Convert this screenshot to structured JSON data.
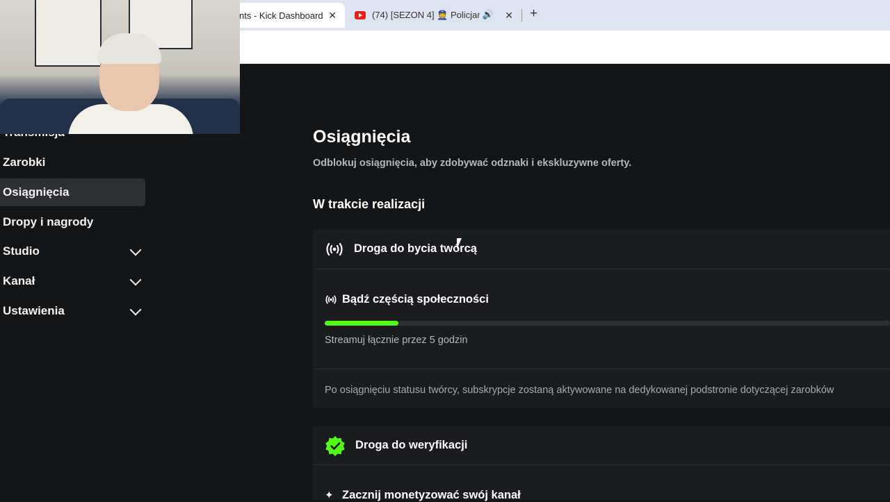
{
  "browser": {
    "tabs": [
      {
        "title": "nts - Kick Dashboard",
        "close": "✕"
      },
      {
        "title": "(74) [SEZON 4] 👮 Policjanc",
        "close": "✕",
        "audio": "🔊"
      }
    ],
    "new_tab": "+"
  },
  "sidebar": {
    "items": [
      {
        "label": "Transmisja"
      },
      {
        "label": "Zarobki"
      },
      {
        "label": "Osiągnięcia",
        "active": true
      },
      {
        "label": "Dropy i nagrody"
      },
      {
        "label": "Studio",
        "expandable": true
      },
      {
        "label": "Kanał",
        "expandable": true
      },
      {
        "label": "Ustawienia",
        "expandable": true
      }
    ]
  },
  "main": {
    "title": "Osiągnięcia",
    "subtitle": "Odblokuj osiągnięcia, aby zdobywać odznaki i ekskluzywne oferty.",
    "section_title": "W trakcie realizacji",
    "groups": [
      {
        "title": "Droga do bycia twórcą",
        "icon": "broadcast-icon",
        "achievement": {
          "title": "Bądź częścią społeczności",
          "progress": 0.13,
          "description": "Streamuj łącznie przez 5 godzin"
        },
        "note": "Po osiągnięciu statusu twórcy, subskrypcje zostaną aktywowane na dedykowanej podstronie dotyczącej zarobków"
      },
      {
        "title": "Droga do weryfikacji",
        "icon": "verified-badge-icon",
        "achievement": {
          "title": "Zacznij monetyzować swój kanał",
          "icon": "sparkle-icon"
        }
      }
    ]
  },
  "colors": {
    "accent": "#53fc18",
    "background": "#141517",
    "card": "#1b1c1f"
  }
}
